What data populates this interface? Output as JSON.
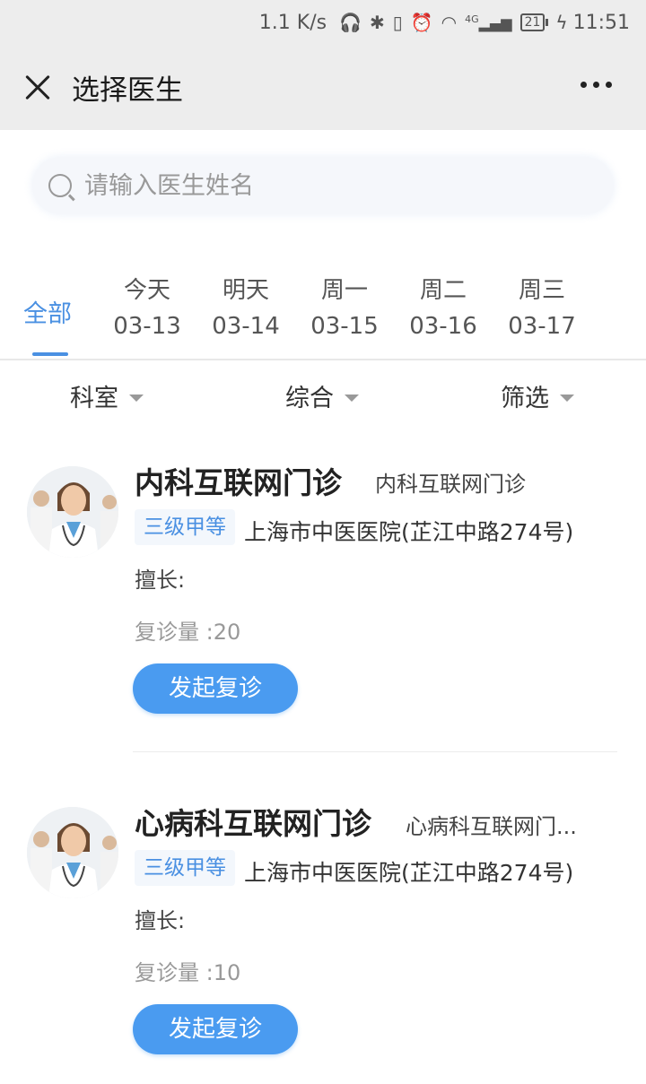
{
  "status_bar": {
    "speed": "1.1 K/s",
    "network": "4G",
    "battery": "21",
    "time": "11:51"
  },
  "nav": {
    "title": "选择医生"
  },
  "search": {
    "placeholder": "请输入医生姓名"
  },
  "date_tabs": {
    "all_label": "全部",
    "days": [
      {
        "day": "今天",
        "date": "03-13"
      },
      {
        "day": "明天",
        "date": "03-14"
      },
      {
        "day": "周一",
        "date": "03-15"
      },
      {
        "day": "周二",
        "date": "03-16"
      },
      {
        "day": "周三",
        "date": "03-17"
      }
    ]
  },
  "filters": {
    "department": "科室",
    "sort": "综合",
    "filter": "筛选"
  },
  "doctors": [
    {
      "name": "内科互联网门诊",
      "department": "内科互联网门诊",
      "level": "三级甲等",
      "hospital": "上海市中医医院(芷江中路274号)",
      "specialty": "擅长:",
      "revisit_count": "复诊量 :20",
      "button": "发起复诊"
    },
    {
      "name": "心病科互联网门诊",
      "department": "心病科互联网门...",
      "level": "三级甲等",
      "hospital": "上海市中医医院(芷江中路274号)",
      "specialty": "擅长:",
      "revisit_count": "复诊量 :10",
      "button": "发起复诊"
    }
  ],
  "colors": {
    "accent": "#4a90e2",
    "button": "#4a9bf0",
    "nav_bg": "#ededed"
  }
}
